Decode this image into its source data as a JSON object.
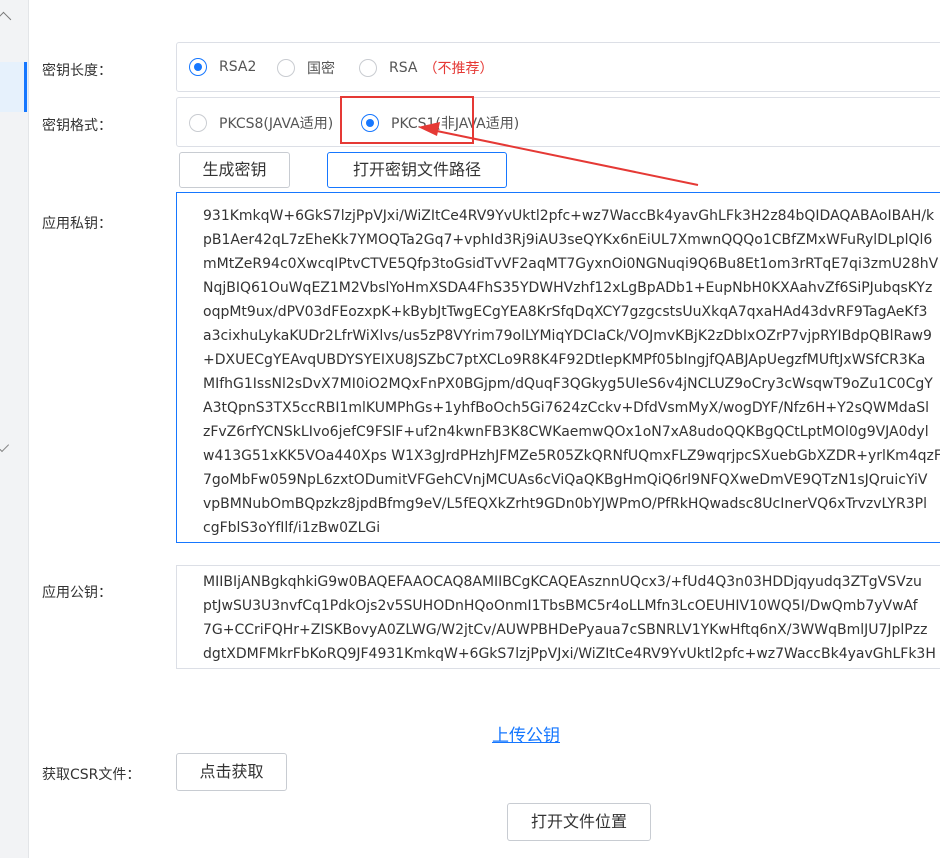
{
  "form": {
    "key_length": {
      "label": "密钥长度：",
      "options": [
        {
          "label": "RSA2",
          "selected": true
        },
        {
          "label": "国密",
          "selected": false
        },
        {
          "label": "RSA",
          "selected": false,
          "note": "（不推荐）"
        }
      ]
    },
    "key_format": {
      "label": "密钥格式：",
      "options": [
        {
          "label": "PKCS8(JAVA适用)",
          "selected": false
        },
        {
          "label": "PKCS1(非JAVA适用)",
          "selected": true
        }
      ]
    },
    "buttons": {
      "generate": "生成密钥",
      "open_key_path": "打开密钥文件路径"
    },
    "private_key": {
      "label": "应用私钥：",
      "lines": [
        "931KmkqW+6GkS7lzjPpVJxi/WiZItCe4RV9YvUktl2pfc+wz7WaccBk4yavGhLFk3H2z84bQIDAQABAoIBAH/k",
        "pB1Aer42qL7zEheKk7YMOQTa2Gq7+vphId3Rj9iAU3seQYKx6nEiUL7XmwnQQQo1CBfZMxWFuRylDLplQl6",
        "mMtZeR94c0XwcqIPtvCTVE5Qfp3toGsidTvVF2aqMT7GyxnOi0NGNuqi9Q6Bu8Et1om3rRTqE7qi3zmU28hV",
        "NqjBIQ61OuWqEZ1M2VbslYoHmXSDA4FhS35YDWHVzhf12xLgBpADb1+EupNbH0KXAahvZf6SiPJubqsKYz",
        "oqpMt9ux/dPV03dFEozxpK+kBybJtTwgECgYEA8KrSfqDqXCY7gzgcstsUuXkqA7qxaHAd43dvRF9TagAeKf3",
        "a3cixhuLykaKUDr2LfrWiXlvs/us5zP8VYrim79olLYMiqYDCIaCk/VOJmvKBjK2zDbIxOZrP7vjpRYIBdpQBlRaw9",
        "+DXUECgYEAvqUBDYSYEIXU8JSZbC7ptXCLo9R8K4F92DtIepKMPf05bIngjfQABJApUegzfMUftJxWSfCR3Ka",
        "MIfhG1IssNl2sDvX7MI0iO2MQxFnPX0BGjpm/dQuqF3QGkyg5UIeS6v4jNCLUZ9oCry3cWsqwT9oZu1C0CgY",
        "A3tQpnS3TX5ccRBI1mlKUMPhGs+1yhfBoOch5Gi7624zCckv+DfdVsmMyX/wogDYF/Nfz6H+Y2sQWMdaSl",
        "zFvZ6rfYCNSkLIvo6jefC9FSlF+uf2n4kwnFB3K8CWKaemwQOx1oN7xA8udoQQKBgQCtLptMOl0g9VJA0dyl",
        "w413G51xKK5VOa440Xps W1X3gJrdPHzhJFMZe5R05ZkQRNfUQmxFLZ9wqrjpcSXuebGbXZDR+yrlKm4qzF",
        "7goMbFw059NpL6zxtODumitVFGehCVnjMCUAs6cViQaQKBgHmQiQ6rl9NFQXweDmVE9QTzN1sJQruicYiV",
        "vpBMNubOmBQpzkz8jpdBfmg9eV/L5fEQXkZrht9GDn0bYJWPmO/PfRkHQwadsc8UcInerVQ6xTrvzvLYR3Pl",
        "cgFblS3oYfIlf/i1zBw0ZLGi"
      ]
    },
    "public_key": {
      "label": "应用公钥：",
      "lines": [
        "MIIBIjANBgkqhkiG9w0BAQEFAAOCAQ8AMIIBCgKCAQEAsznnUQcx3/+fUd4Q3n03HDDjqyudq3ZTgVSVzu",
        "ptJwSU3U3nvfCq1PdkOjs2v5SUHODnHQoOnmI1TbsBMC5r4oLLMfn3LcOEUHIV10WQ5I/DwQmb7yVwAf",
        "7G+CCriFQHr+ZISKBovyA0ZLWG/W2jtCv/AUWPBHDePyaua7cSBNRLV1YKwHftq6nX/3WWqBmlJU7JplPzz",
        "dgtXDMFMkrFbKoRQ9JF4931KmkqW+6GkS7lzjPpVJxi/WiZItCe4RV9YvUktl2pfc+wz7WaccBk4yavGhLFk3H"
      ]
    },
    "upload_public_key": "上传公钥",
    "csr": {
      "label": "获取CSR文件：",
      "button": "点击获取"
    },
    "open_file_location": "打开文件位置"
  },
  "colors": {
    "accent": "#1677ff",
    "annotation": "#e53935"
  }
}
